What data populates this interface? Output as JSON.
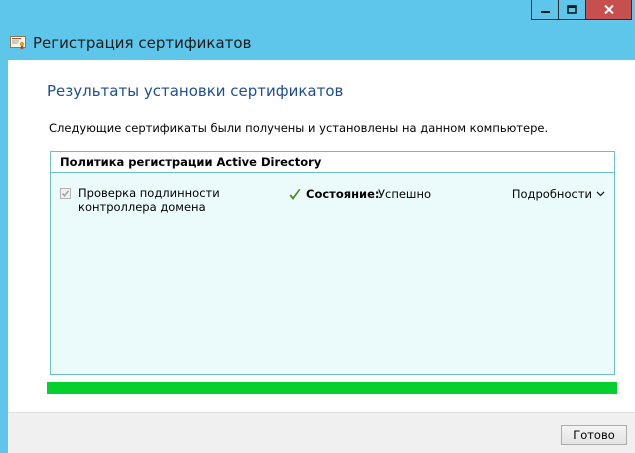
{
  "window": {
    "title": "Регистрация сертификатов",
    "controls": {
      "minimize_icon": "minimize-icon",
      "maximize_icon": "maximize-icon",
      "close_icon": "close-icon"
    }
  },
  "content": {
    "heading": "Результаты установки сертификатов",
    "description": "Следующие сертификаты были получены и установлены на данном компьютере."
  },
  "policy_panel": {
    "header": "Политика регистрации Active Directory",
    "certificates": [
      {
        "name": "Проверка подлинности контроллера домена",
        "checked": true,
        "status_label": "Состояние:",
        "status_value": "Успешно",
        "status_icon": "checkmark-icon",
        "details_label": "Подробности",
        "details_icon": "chevron-down-icon"
      }
    ]
  },
  "progress": {
    "value": 1.0,
    "color": "#06d02d"
  },
  "footer": {
    "done_label": "Готово"
  }
}
